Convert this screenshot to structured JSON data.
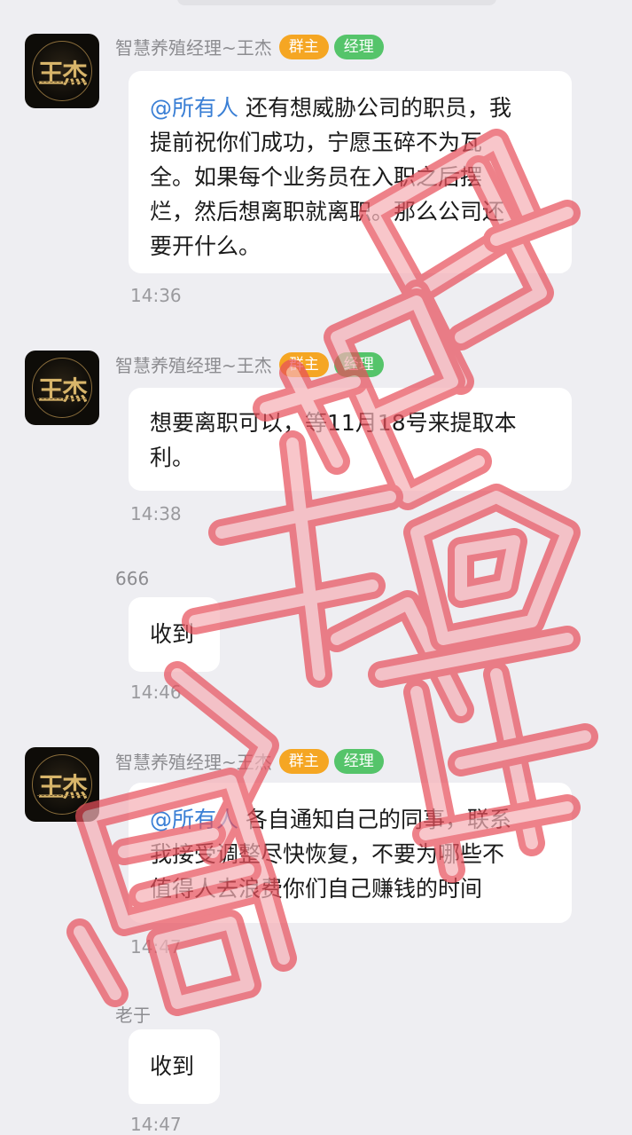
{
  "messages": [
    {
      "sender": "智慧养殖经理~王杰",
      "badges": [
        "群主",
        "经理"
      ],
      "avatar_text": "王杰",
      "mention": "@所有人",
      "lines": [
        "还有想威胁公司的职员，我",
        "提前祝你们成功，宁愿玉碎不为瓦",
        "全。如果每个业务员在入职之后摆",
        "烂，然后想离职就离职。那么公司还",
        "要开什么。"
      ],
      "time": "14:36"
    },
    {
      "sender": "智慧养殖经理~王杰",
      "badges": [
        "群主",
        "经理"
      ],
      "avatar_text": "王杰",
      "lines": [
        "想要离职可以，等11月18号来提取本",
        "利。"
      ],
      "time": "14:38"
    },
    {
      "sender": "666",
      "text": "收到",
      "time": "14:46"
    },
    {
      "sender": "智慧养殖经理~王杰",
      "badges": [
        "群主",
        "经理"
      ],
      "avatar_text": "王杰",
      "mention": "@所有人",
      "lines": [
        "各自通知自己的同事，联系",
        "我接受调整尽快恢复，不要为哪些不",
        "值得人去浪费你们自己赚钱的时间"
      ],
      "time": "14:47"
    },
    {
      "sender": "老于",
      "text": "收到",
      "time": "14:47"
    }
  ],
  "watermark": {
    "color": "#e8505b"
  }
}
